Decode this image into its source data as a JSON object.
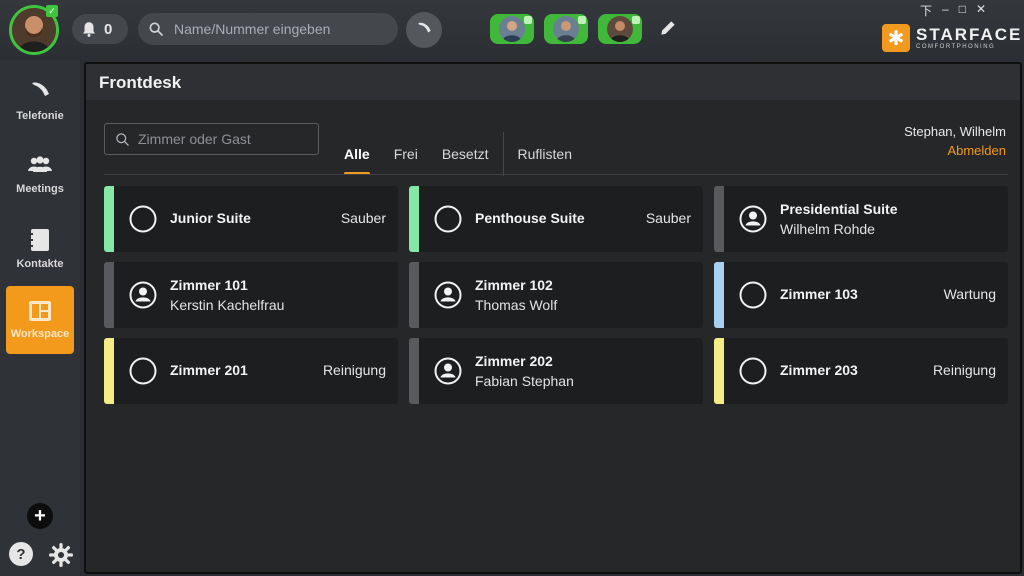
{
  "header": {
    "notification_count": "0",
    "search_placeholder": "Name/Nummer eingeben",
    "window_controls": [
      "下",
      "–",
      "□",
      "✕"
    ],
    "logo": {
      "brand": "STARFACE",
      "tagline": "COMFORTPHONING"
    }
  },
  "sidebar": {
    "items": [
      {
        "label": "Telefonie",
        "icon": "phone-icon"
      },
      {
        "label": "Meetings",
        "icon": "meetings-icon"
      },
      {
        "label": "Kontakte",
        "icon": "contacts-icon"
      },
      {
        "label": "Workspace",
        "icon": "workspace-icon",
        "active": true
      }
    ],
    "help_label": "?"
  },
  "panel": {
    "title": "Frontdesk",
    "search_placeholder": "Zimmer oder Gast",
    "tabs": [
      "Alle",
      "Frei",
      "Besetzt",
      "Ruflisten"
    ],
    "user_name": "Stephan, Wilhelm",
    "logout_label": "Abmelden"
  },
  "rooms": [
    {
      "name": "Junior Suite",
      "guest": "",
      "status": "Sauber",
      "color": "#86e8a6",
      "occupied": false
    },
    {
      "name": "Penthouse Suite",
      "guest": "",
      "status": "Sauber",
      "color": "#86e8a6",
      "occupied": false
    },
    {
      "name": "Presidential Suite",
      "guest": "Wilhelm Rohde",
      "status": "",
      "color": "#595a5d",
      "occupied": true
    },
    {
      "name": "Zimmer 101",
      "guest": "Kerstin Kachelfrau",
      "status": "",
      "color": "#595a5d",
      "occupied": true
    },
    {
      "name": "Zimmer 102",
      "guest": "Thomas Wolf",
      "status": "",
      "color": "#595a5d",
      "occupied": true
    },
    {
      "name": "Zimmer 103",
      "guest": "",
      "status": "Wartung",
      "color": "#a8d0f2",
      "occupied": false
    },
    {
      "name": "Zimmer 201",
      "guest": "",
      "status": "Reinigung",
      "color": "#f5ec86",
      "occupied": false
    },
    {
      "name": "Zimmer 202",
      "guest": "Fabian Stephan",
      "status": "",
      "color": "#595a5d",
      "occupied": true
    },
    {
      "name": "Zimmer 203",
      "guest": "",
      "status": "Reinigung",
      "color": "#f5ec86",
      "occupied": false
    }
  ]
}
